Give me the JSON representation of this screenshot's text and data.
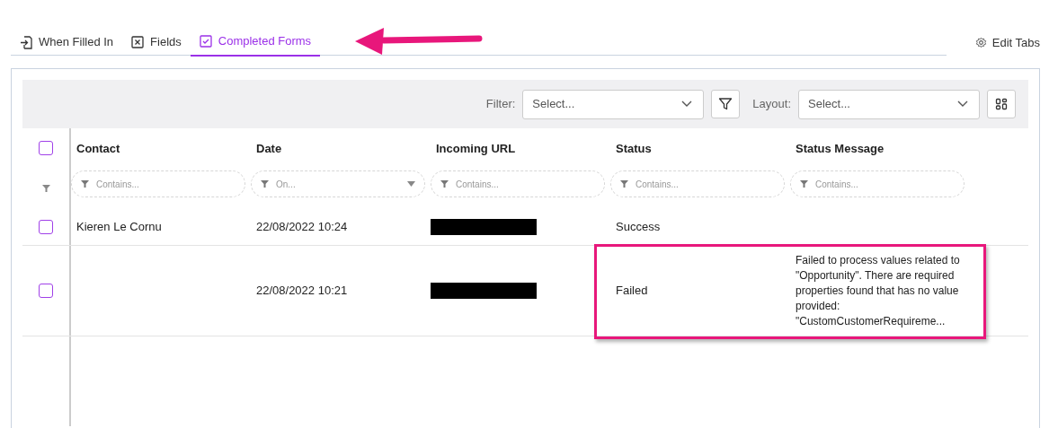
{
  "tabs": [
    {
      "label": "When Filled In",
      "kind": "enter",
      "selected": false
    },
    {
      "label": "Fields",
      "kind": "xbox",
      "selected": false
    },
    {
      "label": "Completed Forms",
      "kind": "checkbox",
      "selected": true
    }
  ],
  "edit_tabs": {
    "label": "Edit Tabs"
  },
  "toolbar": {
    "filter": {
      "label": "Filter:",
      "placeholder": "Select..."
    },
    "layout": {
      "label": "Layout:",
      "placeholder": "Select..."
    }
  },
  "table": {
    "select_all": {
      "checked": false
    },
    "columns": [
      "Contact",
      "Date",
      "Incoming URL",
      "Status",
      "Status Message"
    ],
    "filters": [
      {
        "kind": "text",
        "placeholder": "Contains..."
      },
      {
        "kind": "date",
        "placeholder": "On..."
      },
      {
        "kind": "text",
        "placeholder": "Contains..."
      },
      {
        "kind": "text",
        "placeholder": "Contains..."
      },
      {
        "kind": "text",
        "placeholder": "Contains..."
      }
    ],
    "rows": [
      {
        "checked": false,
        "highlighted": false,
        "cells": [
          {
            "kind": "text",
            "text": "Kieren Le Cornu"
          },
          {
            "kind": "text",
            "text": "22/08/2022 10:24"
          },
          {
            "kind": "redacted"
          },
          {
            "kind": "text",
            "text": "Success"
          },
          {
            "kind": "empty"
          }
        ]
      },
      {
        "checked": false,
        "highlighted": true,
        "cells": [
          {
            "kind": "empty"
          },
          {
            "kind": "text",
            "text": "22/08/2022 10:21"
          },
          {
            "kind": "redacted"
          },
          {
            "kind": "text",
            "text": "Failed"
          },
          {
            "kind": "text",
            "text": "Failed to process values related to \"Opportunity\". There are required properties found that has no value provided: \"CustomCustomerRequireme..."
          }
        ]
      }
    ]
  },
  "annotation": {
    "arrow": true
  }
}
